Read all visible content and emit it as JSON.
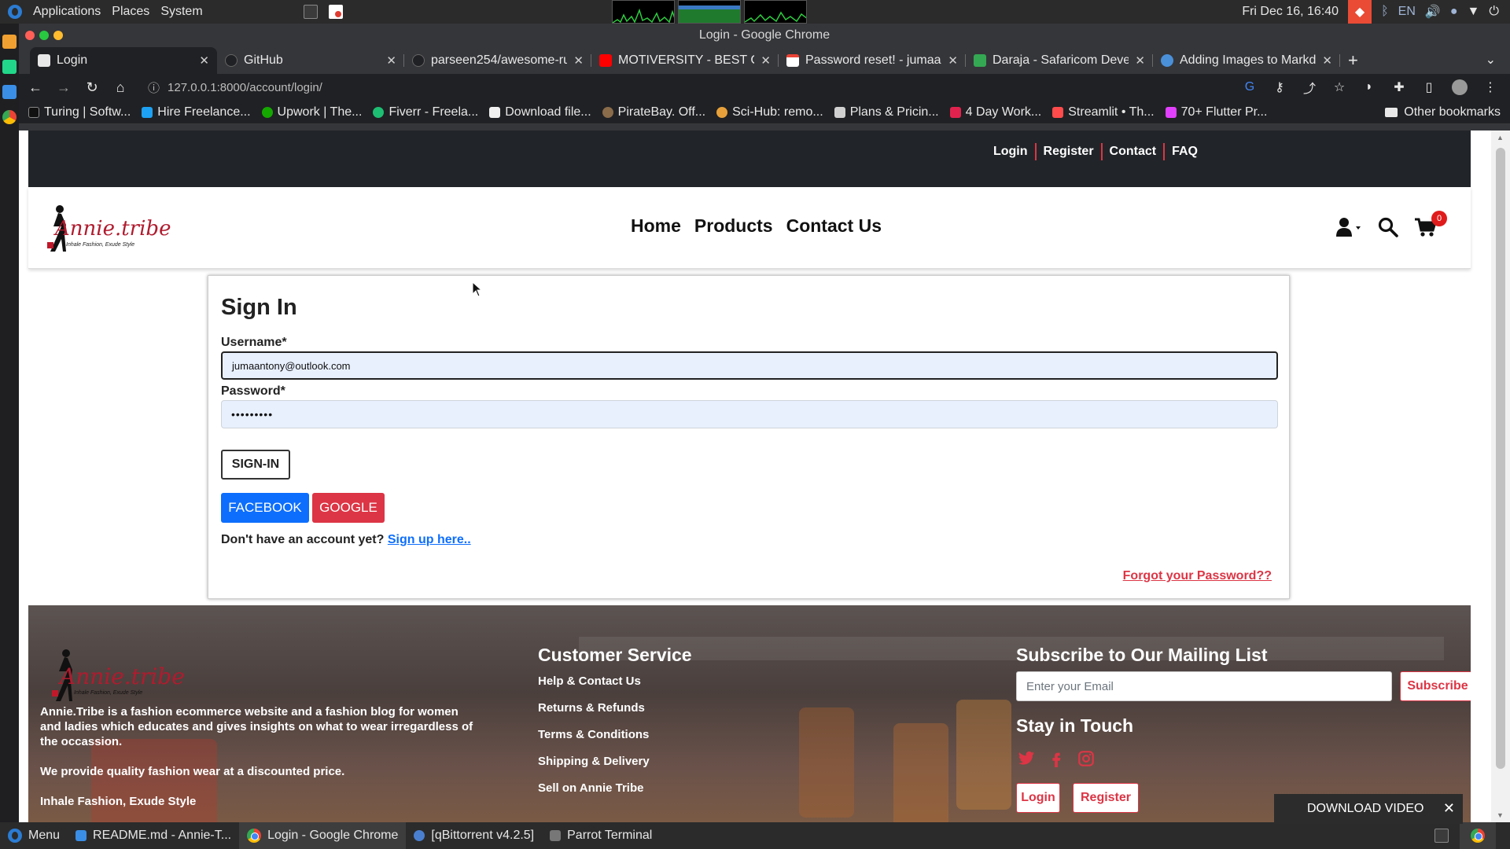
{
  "os_panel": {
    "menu": [
      "Applications",
      "Places",
      "System"
    ],
    "clock": "Fri Dec 16, 16:40",
    "lang": "EN"
  },
  "window": {
    "title": "Login - Google Chrome"
  },
  "tabs": [
    {
      "title": "Login",
      "active": true,
      "fav": "#e8e8e8"
    },
    {
      "title": "GitHub",
      "active": false,
      "fav": "#202124"
    },
    {
      "title": "parseen254/awesome-ru",
      "active": false,
      "fav": "#202124"
    },
    {
      "title": "MOTIVERSITY - BEST C",
      "active": false,
      "fav": "#ff0000"
    },
    {
      "title": "Password reset! - jumaa",
      "active": false,
      "fav": "#ea4335"
    },
    {
      "title": "Daraja - Safaricom Devel",
      "active": false,
      "fav": "#34a853"
    },
    {
      "title": "Adding Images to Markd",
      "active": false,
      "fav": "#4a90d9"
    }
  ],
  "address_bar": {
    "url": "127.0.0.1:8000/account/login/"
  },
  "bookmarks": [
    {
      "label": "Turing | Softw...",
      "color": "#111111"
    },
    {
      "label": "Hire Freelance...",
      "color": "#1da1f2"
    },
    {
      "label": "Upwork | The...",
      "color": "#14a800"
    },
    {
      "label": "Fiverr - Freela...",
      "color": "#1dbf73"
    },
    {
      "label": "Download file...",
      "color": "#f0f0f0"
    },
    {
      "label": "PirateBay. Off...",
      "color": "#8a6b4a"
    },
    {
      "label": "Sci-Hub: remo...",
      "color": "#e8a13a"
    },
    {
      "label": "Plans & Pricin...",
      "color": "#d0d0d0"
    },
    {
      "label": "4 Day Work...",
      "color": "#e0234e"
    },
    {
      "label": "Streamlit • Th...",
      "color": "#ff4b4b"
    },
    {
      "label": "70+ Flutter Pr...",
      "color": "#e040fb"
    }
  ],
  "other_bookmarks": "Other bookmarks",
  "site": {
    "top_links": [
      "Login",
      "Register",
      "Contact",
      "FAQ"
    ],
    "logo_text": "Annie.tribe",
    "logo_tagline": "Inhale Fashion, Exude Style",
    "nav": [
      "Home",
      "Products",
      "Contact Us"
    ],
    "cart_count": "0"
  },
  "signin": {
    "title": "Sign In",
    "username_label": "Username*",
    "username_value": "jumaantony@outlook.com",
    "password_label": "Password*",
    "password_value": "•••••••••",
    "signin_button": "SIGN-IN",
    "facebook_button": "FACEBOOK",
    "google_button": "GOOGLE",
    "no_account_text": "Don't have an account yet?",
    "signup_link": "Sign up here..",
    "forgot_link": "Forgot your Password??"
  },
  "footer": {
    "about_1": "Annie.Tribe is a fashion ecommerce website and a fashion blog for women and ladies which educates and gives insights on what to wear irregardless of the occassion.",
    "about_2": "We provide quality fashion wear at a discounted price.",
    "about_3": "Inhale Fashion, Exude Style",
    "cs_heading": "Customer Service",
    "cs_links": [
      "Help & Contact Us",
      "Returns & Refunds",
      "Terms & Conditions",
      "Shipping & Delivery",
      "Sell on Annie Tribe"
    ],
    "mail_heading": "Subscribe to Our Mailing List",
    "email_placeholder": "Enter your Email",
    "subscribe_button": "Subscribe",
    "stay_heading": "Stay in Touch",
    "login_button": "Login",
    "register_button": "Register"
  },
  "download_video": {
    "label": "DOWNLOAD VIDEO"
  },
  "taskbar": [
    {
      "label": "Menu",
      "color": "#2b7cd3",
      "active": false
    },
    {
      "label": "README.md - Annie-T...",
      "color": "#3a8ee6",
      "active": false
    },
    {
      "label": "Login - Google Chrome",
      "color": "#f4b400",
      "active": true
    },
    {
      "label": "[qBittorrent v4.2.5]",
      "color": "#4a7fd0",
      "active": false
    },
    {
      "label": "Parrot Terminal",
      "color": "#777777",
      "active": false
    }
  ]
}
